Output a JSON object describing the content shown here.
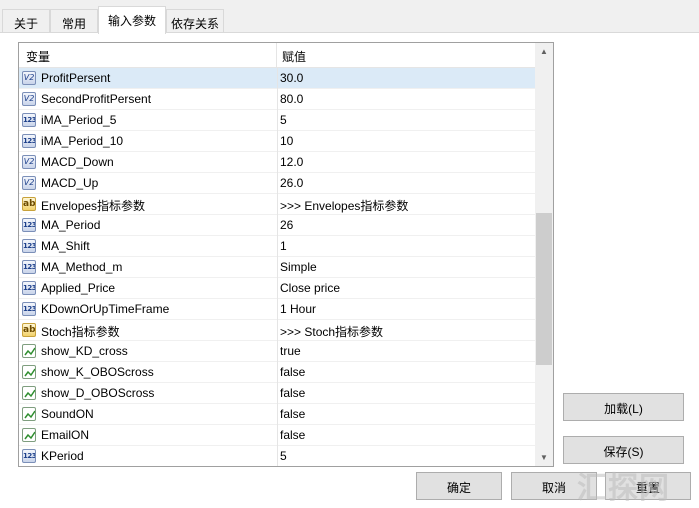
{
  "tabs": [
    {
      "label": "关于",
      "active": false
    },
    {
      "label": "常用",
      "active": false
    },
    {
      "label": "输入参数",
      "active": true
    },
    {
      "label": "依存关系",
      "active": false
    }
  ],
  "grid": {
    "header": {
      "variable": "变量",
      "value": "赋值"
    },
    "rows": [
      {
        "type": "double",
        "name": "ProfitPersent",
        "value": "30.0",
        "selected": true
      },
      {
        "type": "double",
        "name": "SecondProfitPersent",
        "value": "80.0"
      },
      {
        "type": "int",
        "name": "iMA_Period_5",
        "value": "5"
      },
      {
        "type": "int",
        "name": "iMA_Period_10",
        "value": "10"
      },
      {
        "type": "double",
        "name": "MACD_Down",
        "value": "12.0"
      },
      {
        "type": "double",
        "name": "MACD_Up",
        "value": "26.0"
      },
      {
        "type": "string",
        "name": "Envelopes指标参数",
        "value": ">>> Envelopes指标参数"
      },
      {
        "type": "int",
        "name": "MA_Period",
        "value": "26"
      },
      {
        "type": "int",
        "name": "MA_Shift",
        "value": "1"
      },
      {
        "type": "int",
        "name": "MA_Method_m",
        "value": "Simple"
      },
      {
        "type": "int",
        "name": "Applied_Price",
        "value": "Close price"
      },
      {
        "type": "int",
        "name": "KDownOrUpTimeFrame",
        "value": "1 Hour"
      },
      {
        "type": "string",
        "name": "Stoch指标参数",
        "value": ">>> Stoch指标参数"
      },
      {
        "type": "bool",
        "name": "show_KD_cross",
        "value": "true"
      },
      {
        "type": "bool",
        "name": "show_K_OBOScross",
        "value": "false"
      },
      {
        "type": "bool",
        "name": "show_D_OBOScross",
        "value": "false"
      },
      {
        "type": "bool",
        "name": "SoundON",
        "value": "false"
      },
      {
        "type": "bool",
        "name": "EmailON",
        "value": "false"
      },
      {
        "type": "int",
        "name": "KPeriod",
        "value": "5"
      }
    ]
  },
  "icons": {
    "int": "123",
    "double": "V2",
    "string": "ab"
  },
  "buttons": {
    "load": "加载(L)",
    "save": "保存(S)",
    "ok": "确定",
    "cancel": "取消",
    "reset": "重置"
  },
  "watermark": "汇探网",
  "colors": {
    "selected_row": "#dbeaf7",
    "background": "#f0f0f0"
  }
}
